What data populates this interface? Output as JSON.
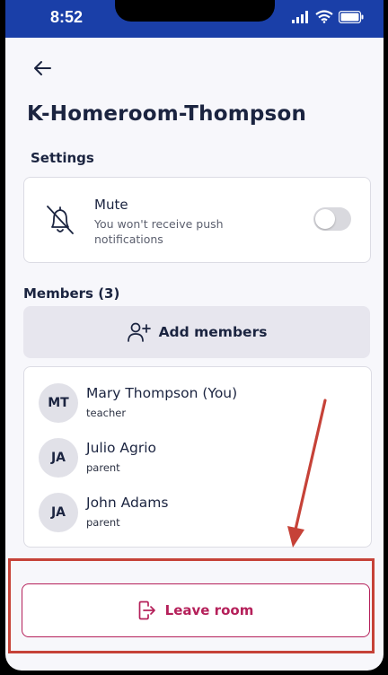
{
  "status_bar": {
    "time": "8:52"
  },
  "header": {
    "title": "K-Homeroom-Thompson"
  },
  "settings": {
    "heading": "Settings",
    "mute": {
      "title": "Mute",
      "subtitle": "You won't receive push notifications",
      "enabled": false
    }
  },
  "members": {
    "heading": "Members (3)",
    "add_label": "Add members",
    "items": [
      {
        "initials": "MT",
        "name": "Mary Thompson (You)",
        "role": "teacher"
      },
      {
        "initials": "JA",
        "name": "Julio Agrio",
        "role": "parent"
      },
      {
        "initials": "JA",
        "name": "John Adams",
        "role": "parent"
      }
    ]
  },
  "leave": {
    "label": "Leave room"
  },
  "colors": {
    "status_bar": "#1a3fa8",
    "leave_accent": "#b5205a",
    "annotation": "#c64238"
  }
}
